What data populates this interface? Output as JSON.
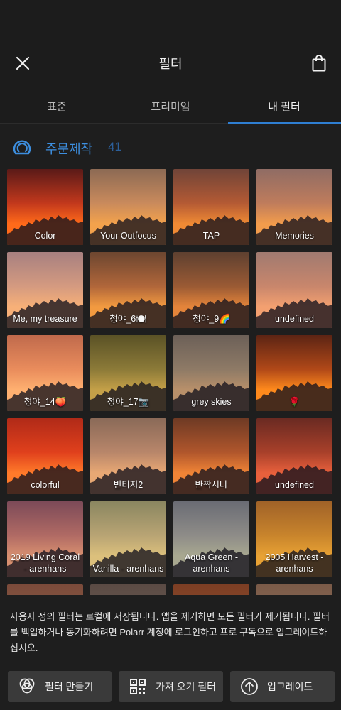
{
  "header": {
    "title": "필터"
  },
  "tabs": [
    {
      "label": "표준",
      "active": false
    },
    {
      "label": "프리미엄",
      "active": false
    },
    {
      "label": "내 필터",
      "active": true
    }
  ],
  "section": {
    "title": "주문제작",
    "count": "41"
  },
  "filters": [
    {
      "label": "Color",
      "top": "#5a1a18",
      "mid": "#c2381c",
      "bottom": "#ff6a1a"
    },
    {
      "label": "Your Outfocus",
      "top": "#8c6a54",
      "mid": "#c98a5c",
      "bottom": "#f3a24c"
    },
    {
      "label": "TAP",
      "top": "#704438",
      "mid": "#b45a34",
      "bottom": "#f08a34"
    },
    {
      "label": "Memories",
      "top": "#8f6c64",
      "mid": "#bf7c5c",
      "bottom": "#f29c4c"
    },
    {
      "label": "Me, my treasure",
      "top": "#a78080",
      "mid": "#d49a80",
      "bottom": "#f7b078"
    },
    {
      "label": "청야_6🍽️",
      "top": "#6c4630",
      "mid": "#b0663a",
      "bottom": "#f29a40"
    },
    {
      "label": "청야_9🌈",
      "top": "#5e4030",
      "mid": "#9a5a34",
      "bottom": "#e4843a"
    },
    {
      "label": "undefined",
      "top": "#a07a70",
      "mid": "#c8866c",
      "bottom": "#f3a070"
    },
    {
      "label": "청야_14🍑",
      "top": "#c06a4c",
      "mid": "#e98c5c",
      "bottom": "#ffb070"
    },
    {
      "label": "청야_17📷",
      "top": "#5a5226",
      "mid": "#8c7a38",
      "bottom": "#c4a048"
    },
    {
      "label": "grey skies",
      "top": "#6c6058",
      "mid": "#8e7a66",
      "bottom": "#b8906a"
    },
    {
      "label": "🌹",
      "top": "#5c2414",
      "mid": "#b04818",
      "bottom": "#ff8a1c"
    },
    {
      "label": "colorful",
      "top": "#b02a18",
      "mid": "#e0401c",
      "bottom": "#ff7a2a"
    },
    {
      "label": "빈티지2",
      "top": "#8a6a58",
      "mid": "#b8866a",
      "bottom": "#e8a874"
    },
    {
      "label": "반짝시나",
      "top": "#6e3a24",
      "mid": "#b0562c",
      "bottom": "#f08436"
    },
    {
      "label": "undefined",
      "top": "#6a2a22",
      "mid": "#a8402a",
      "bottom": "#e8603c"
    },
    {
      "label": "2019 Living Coral - arenhans",
      "top": "#7c4a58",
      "mid": "#b06a64",
      "bottom": "#d89070"
    },
    {
      "label": "Vanilla - arenhans",
      "top": "#8a8660",
      "mid": "#b8a474",
      "bottom": "#dcc07c"
    },
    {
      "label": "Aqua Green - arenhans",
      "top": "#6a6c74",
      "mid": "#8e8c88",
      "bottom": "#a8a890"
    },
    {
      "label": "2005 Harvest - arenhans",
      "top": "#a06228",
      "mid": "#c8842c",
      "bottom": "#e8a234"
    },
    {
      "label": "",
      "top": "#7a4a3a",
      "mid": "#8a5a44",
      "bottom": "#9a6a50"
    },
    {
      "label": "",
      "top": "#5a4a44",
      "mid": "#6a5a50",
      "bottom": "#7a6a5a"
    },
    {
      "label": "",
      "top": "#7c3e24",
      "mid": "#8c4a2a",
      "bottom": "#9c5a34"
    },
    {
      "label": "",
      "top": "#7a5a48",
      "mid": "#8a6a54",
      "bottom": "#9a7a60"
    }
  ],
  "notice": {
    "text": "사용자 정의 필터는 로컬에 저장됩니다. 앱을 제거하면 모든 필터가 제거됩니다. 필터를 백업하거나 동기화하려면 Polarr 계정에 로그인하고 프로 구독으로 업그레이드하십시오."
  },
  "buttons": {
    "create": "필터 만들기",
    "import": "가져 오기 필터",
    "upgrade": "업그레이드"
  },
  "colors": {
    "accent": "#2f7fd3",
    "background": "#1e1e1e",
    "button": "#3a3a3a"
  }
}
